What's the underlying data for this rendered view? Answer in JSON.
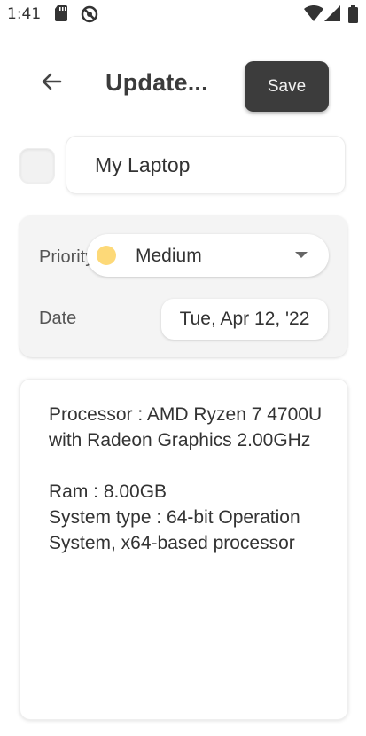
{
  "status_bar": {
    "time": "1:41",
    "icons": [
      "sd-card-icon",
      "no-disturb-icon",
      "wifi-icon",
      "signal-icon",
      "battery-icon"
    ]
  },
  "header": {
    "back_icon": "arrow-left-icon",
    "title": "Update...",
    "save_label": "Save"
  },
  "item": {
    "checkbox_checked": false,
    "name": "My Laptop"
  },
  "properties": {
    "priority_label": "Priority",
    "priority_value": "Medium",
    "priority_color": "#fdd978",
    "date_label": "Date",
    "date_value": "Tue, Apr 12, '22"
  },
  "notes": {
    "text": "Processor : AMD Ryzen 7 4700U with Radeon Graphics 2.00GHz\n\nRam : 8.00GB\nSystem type : 64-bit Operation System, x64-based processor"
  },
  "colors": {
    "save_button_bg": "#3c3c3c",
    "card_bg": "#f4f4f4"
  }
}
